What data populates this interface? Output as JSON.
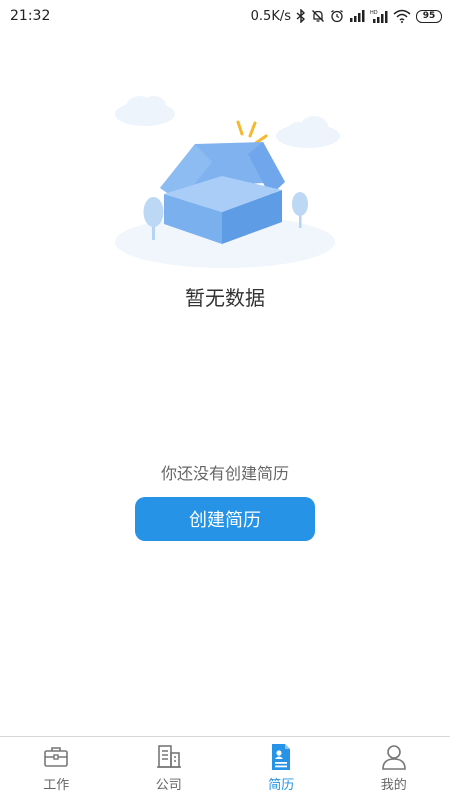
{
  "status_bar": {
    "time": "21:32",
    "net_speed": "0.5K/s",
    "icons": [
      "bluetooth-icon",
      "mute-bell-icon",
      "alarm-icon",
      "signal-icon",
      "hd-signal-icon",
      "wifi-icon"
    ],
    "battery": "95"
  },
  "empty_state": {
    "illustration": "empty-box-icon",
    "title": "暂无数据"
  },
  "resume": {
    "hint": "你还没有创建简历",
    "create_button": "创建简历"
  },
  "bottom_nav": {
    "items": [
      {
        "label": "工作",
        "icon": "briefcase-icon",
        "active": false
      },
      {
        "label": "公司",
        "icon": "building-icon",
        "active": false
      },
      {
        "label": "简历",
        "icon": "resume-icon",
        "active": true
      },
      {
        "label": "我的",
        "icon": "person-icon",
        "active": false
      }
    ]
  },
  "colors": {
    "accent": "#2693e7",
    "inactive_icon": "#777777"
  }
}
